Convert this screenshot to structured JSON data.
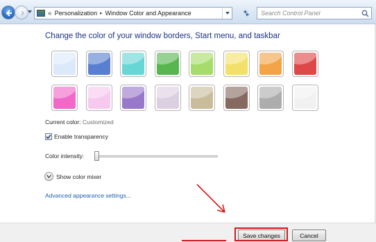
{
  "nav": {
    "breadcrumb": [
      "Personalization",
      "Window Color and Appearance"
    ],
    "search_placeholder": "Search Control Panel"
  },
  "main": {
    "title": "Change the color of your window borders, Start menu, and taskbar",
    "swatches": [
      {
        "name": "default",
        "color": "#dbe9fb"
      },
      {
        "name": "graphite-blue",
        "color": "#5a7fd0"
      },
      {
        "name": "teal",
        "color": "#67d6d4"
      },
      {
        "name": "green",
        "color": "#58b650"
      },
      {
        "name": "lime",
        "color": "#a6dc6a"
      },
      {
        "name": "yellow",
        "color": "#f1e16a"
      },
      {
        "name": "orange",
        "color": "#f2a446"
      },
      {
        "name": "red",
        "color": "#de4848"
      },
      {
        "name": "pink",
        "color": "#f068c8"
      },
      {
        "name": "light-pink",
        "color": "#f7c9ef"
      },
      {
        "name": "purple",
        "color": "#9878c8"
      },
      {
        "name": "lavender",
        "color": "#dccfe0"
      },
      {
        "name": "khaki",
        "color": "#c8bc9a"
      },
      {
        "name": "brown",
        "color": "#866a62"
      },
      {
        "name": "gray",
        "color": "#adadad"
      },
      {
        "name": "frost",
        "color": "#f1f1f1"
      }
    ],
    "current_color_label": "Current color:",
    "current_color_value": "Customized",
    "transparency_label": "Enable transparency",
    "transparency_checked": true,
    "intensity_label": "Color intensity:",
    "intensity_level": 0.0,
    "mixer_label": "Show color mixer",
    "advanced_link": "Advanced appearance settings..."
  },
  "footer": {
    "save_label": "Save changes",
    "cancel_label": "Cancel"
  },
  "colors": {
    "title": "#1e3287",
    "link": "#1f5fb3",
    "annotation": "#d11a1a"
  }
}
